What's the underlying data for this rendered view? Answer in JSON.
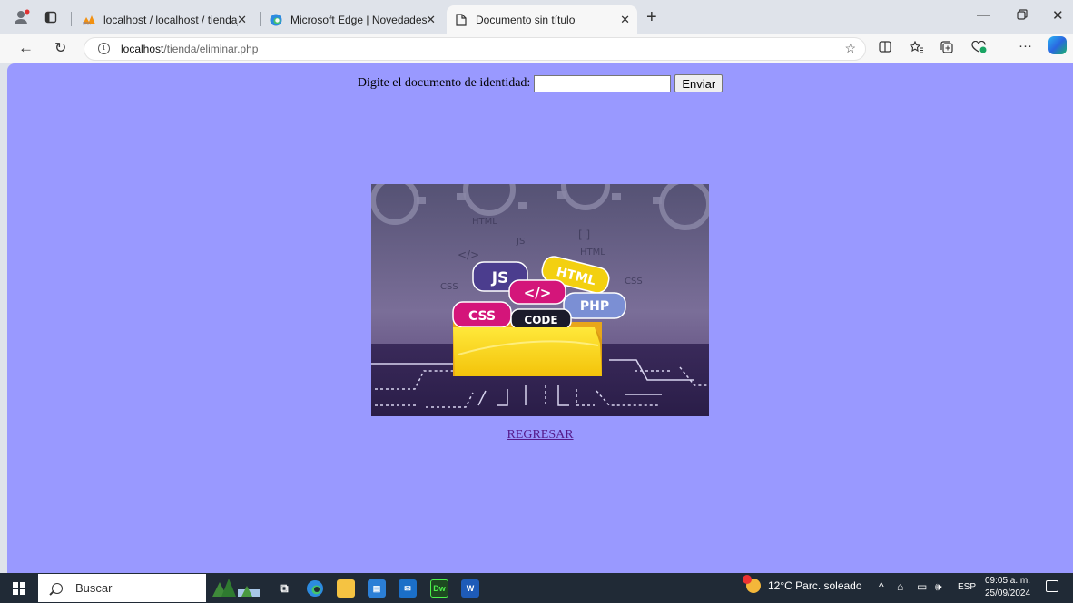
{
  "browser": {
    "tabs": [
      {
        "title": "localhost / localhost / tienda_aba",
        "favicon": "phpmyadmin-icon",
        "active": false
      },
      {
        "title": "Microsoft Edge | Novedades",
        "favicon": "edge-icon",
        "active": false
      },
      {
        "title": "Documento sin título",
        "favicon": "document-icon",
        "active": true
      }
    ],
    "address": {
      "host": "localhost",
      "path": "/tienda/eliminar.php"
    }
  },
  "page": {
    "background_color": "#9999ff",
    "form": {
      "label": "Digite el documento de identidad:",
      "input_value": "",
      "submit_label": "Enviar"
    },
    "image": {
      "tags": [
        "JS",
        "HTML",
        "</>",
        "PHP",
        "CSS",
        "CODE"
      ],
      "background_words": [
        "HTML",
        "JS",
        "</>",
        "[ ]",
        "HTML",
        "CSS",
        "CSS"
      ]
    },
    "back_link": "REGRESAR",
    "link_color": "#551a8b"
  },
  "taskbar": {
    "search_label": "Buscar",
    "weather": "12°C  Parc. soleado",
    "language": "ESP",
    "time": "09:05 a. m.",
    "date": "25/09/2024",
    "apps": [
      "file-explorer-icon",
      "task-view-icon",
      "edge-icon",
      "file-manager-icon",
      "store-icon",
      "mail-icon",
      "dreamweaver-icon",
      "word-icon"
    ]
  }
}
